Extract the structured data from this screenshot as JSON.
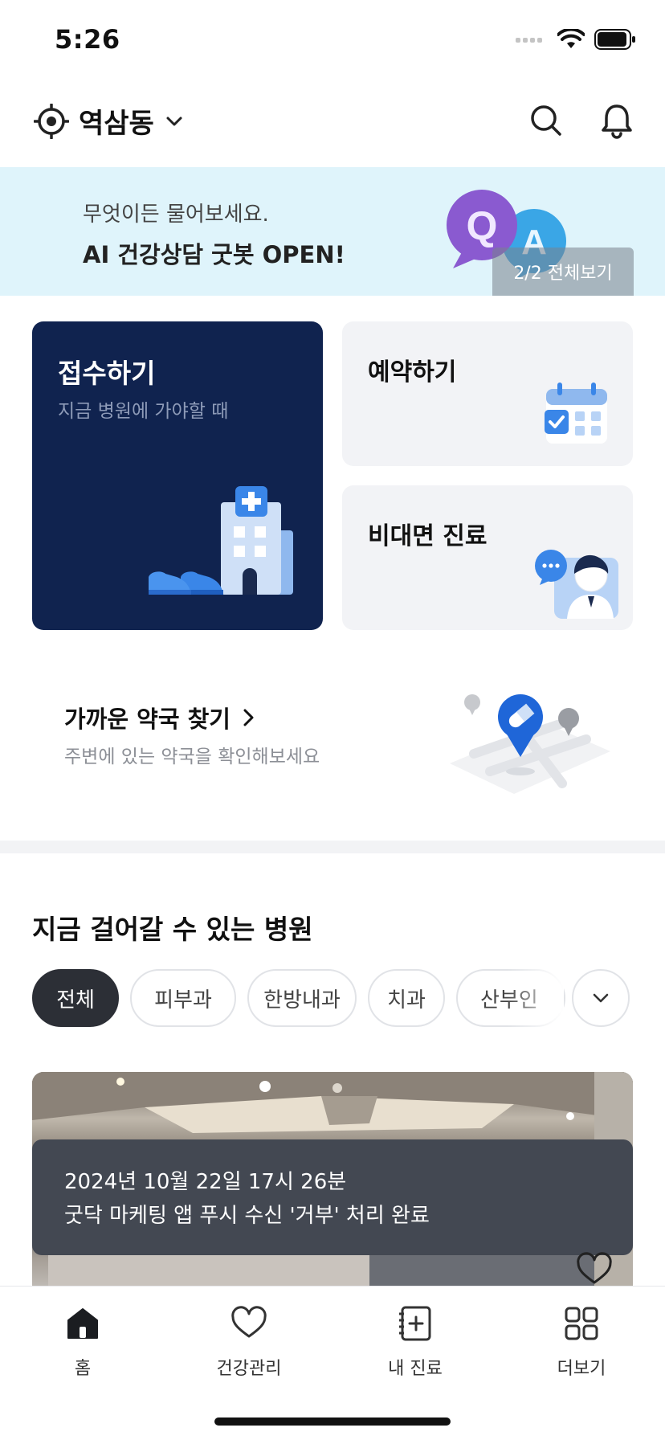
{
  "status": {
    "time": "5:26"
  },
  "header": {
    "location": "역삼동"
  },
  "banner": {
    "subtitle": "무엇이든 물어보세요.",
    "title": "AI 건강상담 굿봇 OPEN!",
    "pager": "2/2 전체보기"
  },
  "cards": {
    "reception": {
      "title": "접수하기",
      "subtitle": "지금 병원에 가야할 때"
    },
    "reservation": {
      "title": "예약하기"
    },
    "telemedicine": {
      "title": "비대면 진료"
    }
  },
  "pharmacy": {
    "title": "가까운 약국 찾기",
    "subtitle": "주변에 있는 약국을 확인해보세요"
  },
  "hospitals": {
    "title": "지금 걸어갈 수 있는 병원",
    "chips": [
      "전체",
      "피부과",
      "한방내과",
      "치과",
      "산부인"
    ]
  },
  "toast": {
    "line1": "2024년 10월 22일 17시 26분",
    "line2": "굿닥 마케팅 앱 푸시 수신 '거부' 처리 완료"
  },
  "tabbar": {
    "items": [
      {
        "label": "홈",
        "icon": "home-icon"
      },
      {
        "label": "건강관리",
        "icon": "heart-icon"
      },
      {
        "label": "내 진료",
        "icon": "medical-record-icon"
      },
      {
        "label": "더보기",
        "icon": "grid-icon"
      }
    ]
  },
  "colors": {
    "banner_bg": "#dff4fb",
    "reception_bg": "#10234f",
    "active_chip": "#2c2f36",
    "toast_bg": "#434852"
  }
}
